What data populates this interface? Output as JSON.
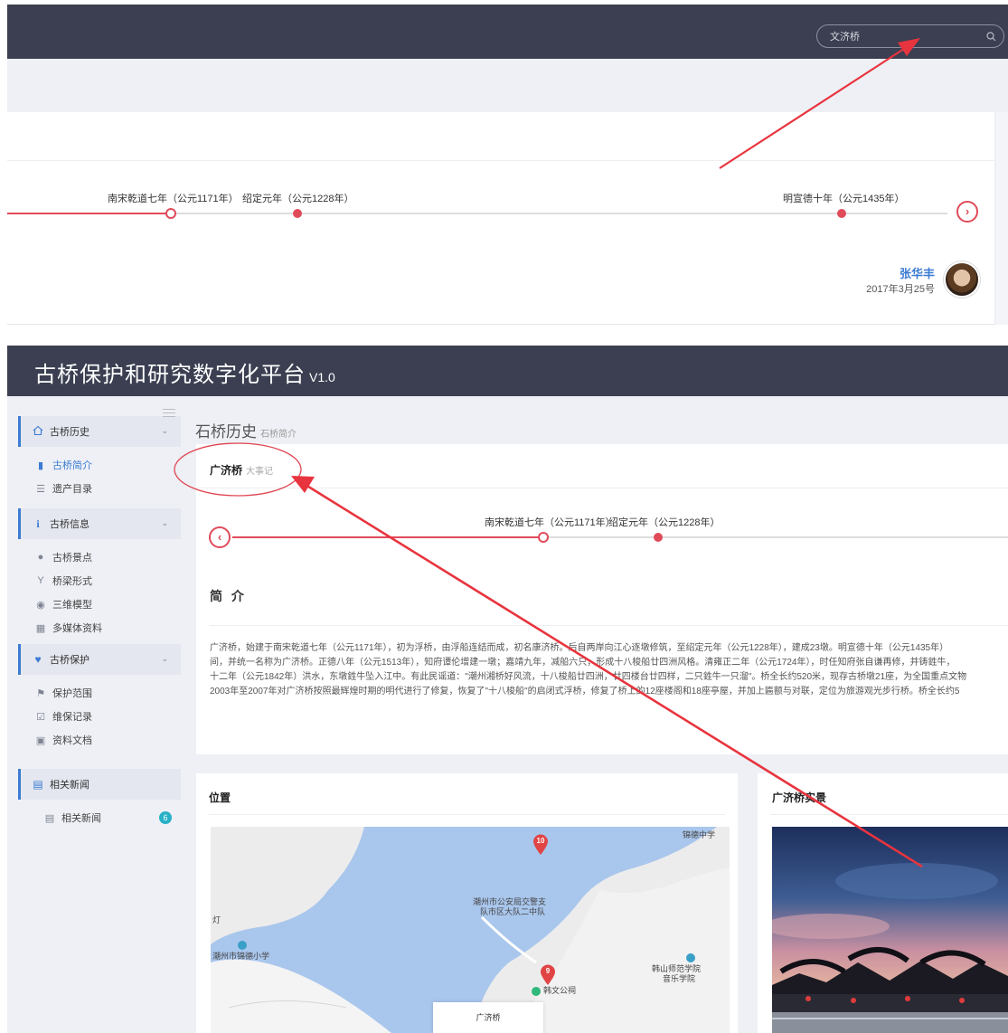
{
  "top": {
    "search": {
      "value": "文济桥"
    },
    "timeline": {
      "events": [
        {
          "label": "南宋乾道七年（公元1171年）"
        },
        {
          "label": "绍定元年（公元1228年）"
        },
        {
          "label": "明宣德十年（公元1435年）"
        }
      ]
    },
    "author": {
      "name": "张华丰",
      "date": "2017年3月25号"
    }
  },
  "header": {
    "title": "古桥保护和研究数字化平台",
    "version": "V1.0"
  },
  "sidebar": {
    "sections": [
      {
        "label": "古桥历史",
        "icon": "home-icon",
        "items": [
          {
            "label": "古桥简介",
            "icon": "book-icon",
            "active": true
          },
          {
            "label": "遗产目录",
            "icon": "list-icon"
          }
        ]
      },
      {
        "label": "古桥信息",
        "icon": "info-icon",
        "items": [
          {
            "label": "古桥景点",
            "icon": "dot-icon"
          },
          {
            "label": "桥梁形式",
            "icon": "y-icon"
          },
          {
            "label": "三维模型",
            "icon": "cube-icon"
          },
          {
            "label": "多媒体资料",
            "icon": "media-file-icon"
          }
        ]
      },
      {
        "label": "古桥保护",
        "icon": "heart-icon",
        "items": [
          {
            "label": "保护范围",
            "icon": "flag-icon"
          },
          {
            "label": "维保记录",
            "icon": "calendar-check-icon"
          },
          {
            "label": "资料文档",
            "icon": "document-icon"
          }
        ]
      },
      {
        "label": "相关新闻",
        "icon": "news-icon",
        "items": [
          {
            "label": "相关新闻",
            "icon": "news-icon",
            "badge": "6"
          }
        ]
      }
    ]
  },
  "page": {
    "title": "石桥历史",
    "subtitle": "石桥简介"
  },
  "card": {
    "title": "广济桥",
    "subtitle": "大事记",
    "timeline": [
      {
        "label": "南宋乾道七年（公元1171年）"
      },
      {
        "label": "绍定元年（公元1228年）"
      }
    ],
    "intro_title": "简 介",
    "intro_lines": [
      "广济桥，始建于南宋乾道七年（公元1171年），初为浮桥，由浮船连结而成，初名康济桥。后自两岸向江心逐墩修筑，至绍定元年（公元1228年），建成23墩。明宣德十年（公元1435年）",
      "间，并统一名称为广济桥。正德八年（公元1513年），知府谭伦增建一墩；嘉靖九年，减船六只，形成十八梭船廿四洲风格。清雍正二年（公元1724年），时任知府张自谦再修，并铸鉎牛，",
      "十二年（公元1842年）洪水，东墩鉎牛坠入江中。有此民谣道：\"潮州湘桥好风流，十八梭船廿四洲，廿四楼台廿四样，二只鉎牛一只溜\"。桥全长约520米，现存古桥墩21座，为全国重点文物",
      "2003年至2007年对广济桥按照最辉煌时期的明代进行了修复，恢复了\"十八梭船\"的启闭式浮桥，修复了桥上的12座楼阁和18座亭屋，并加上匾额与对联，定位为旅游观光步行桥。桥全长约5"
    ]
  },
  "location": {
    "title": "位置",
    "map_labels": {
      "l1": "锦德中学",
      "l2": "潮州市公安局交警支",
      "l3": "队市区大队二中队",
      "l4": "灯",
      "l5": "潮州市锦德小学",
      "l6": "韩山师范学院",
      "l7": "音乐学院",
      "l8": "韩文公祠"
    },
    "markers": [
      "10",
      "9"
    ],
    "popup": "广济桥"
  },
  "photo": {
    "title": "广济桥实景"
  }
}
